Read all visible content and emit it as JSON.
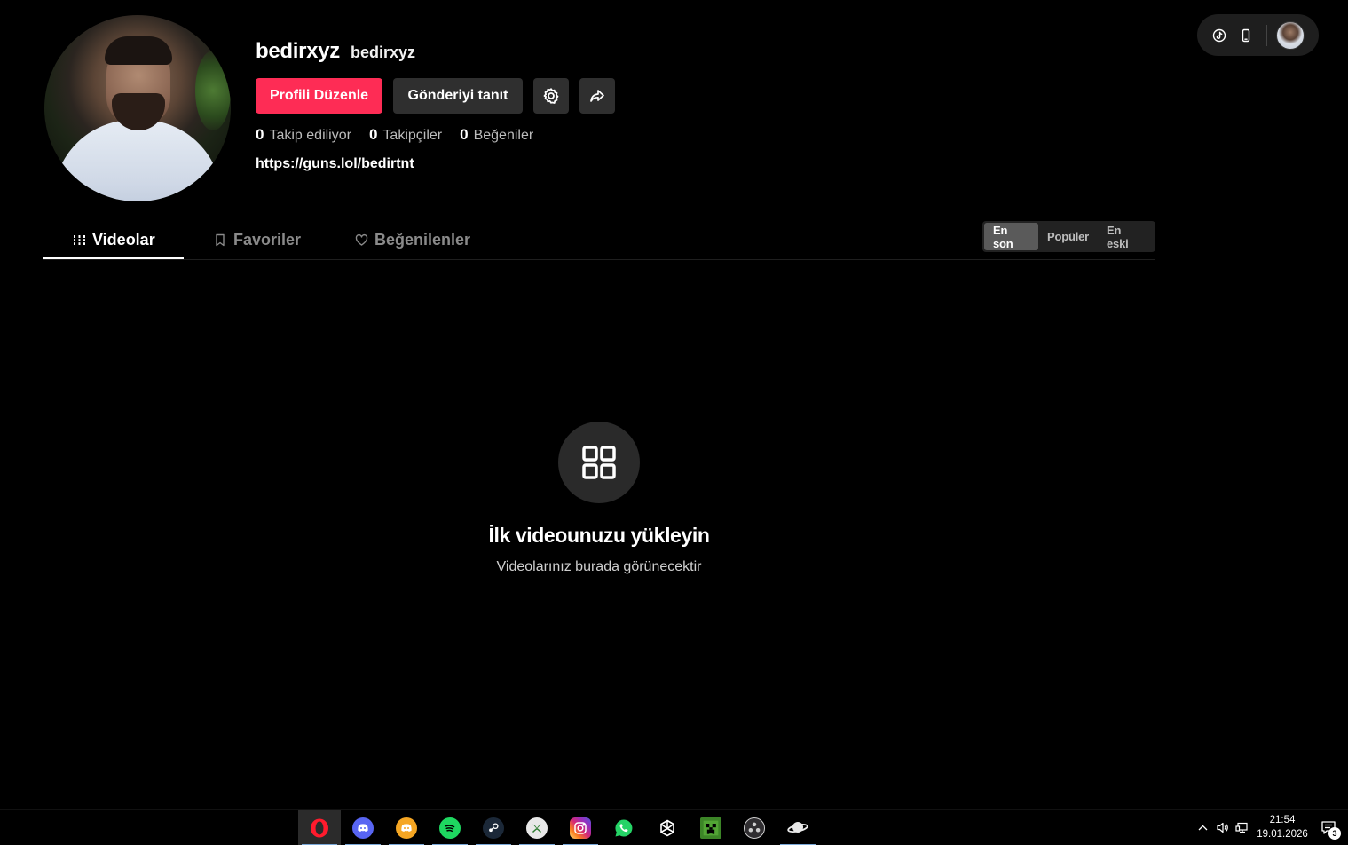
{
  "profile": {
    "display_name": "bedirxyz",
    "username": "bedirxyz",
    "bio_link": "https://guns.lol/bedirtnt"
  },
  "buttons": {
    "edit_profile": "Profili Düzenle",
    "promote_post": "Gönderiyi tanıt"
  },
  "stats": [
    {
      "count": "0",
      "label": "Takip ediliyor"
    },
    {
      "count": "0",
      "label": "Takipçiler"
    },
    {
      "count": "0",
      "label": "Beğeniler"
    }
  ],
  "tabs": [
    {
      "label": "Videolar",
      "icon": "grid-lines-icon",
      "active": true
    },
    {
      "label": "Favoriler",
      "icon": "bookmark-icon",
      "active": false
    },
    {
      "label": "Beğenilenler",
      "icon": "heart-icon",
      "active": false
    }
  ],
  "sort": [
    {
      "label": "En son",
      "active": true
    },
    {
      "label": "Popüler",
      "active": false
    },
    {
      "label": "En eski",
      "active": false
    }
  ],
  "empty_state": {
    "title": "İlk videounuzu yükleyin",
    "subtitle": "Videolarınız burada görünecektir"
  },
  "taskbar": {
    "apps": [
      "opera-icon",
      "discord-icon",
      "discord-ptb-icon",
      "spotify-icon",
      "steam-icon",
      "xbox-icon",
      "instagram-icon",
      "whatsapp-icon",
      "chatgpt-icon",
      "minecraft-icon",
      "obs-icon",
      "planet-app-icon"
    ],
    "time": "21:54",
    "date": "19.01.2026",
    "notification_count": "3"
  },
  "colors": {
    "accent": "#fe2c55",
    "background": "#000000",
    "button_secondary": "#2f2f2f"
  }
}
